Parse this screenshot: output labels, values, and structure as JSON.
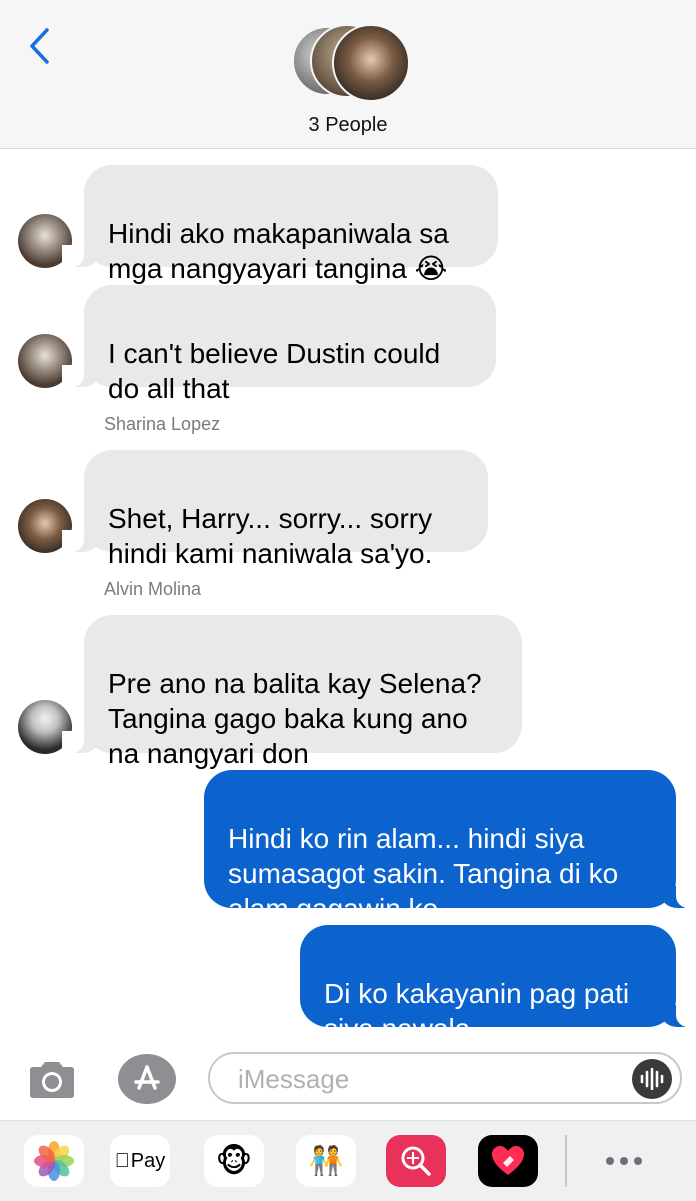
{
  "header": {
    "back_icon": "chevron-left-icon",
    "title": "3 People",
    "accent_color": "#1a6fe0"
  },
  "messages": [
    {
      "direction": "incoming",
      "sender": "",
      "text": "Hindi ako makapaniwala sa\nmga nangyayari tangina 😭"
    },
    {
      "direction": "incoming",
      "sender": "",
      "text": "I can't believe Dustin could\ndo all that"
    },
    {
      "direction": "incoming",
      "sender": "Sharina Lopez",
      "text": "Shet, Harry... sorry... sorry\nhindi kami naniwala sa'yo."
    },
    {
      "direction": "incoming",
      "sender": "Alvin Molina",
      "text": "Pre ano na balita kay Selena?\nTangina gago baka kung ano\nna nangyari don"
    },
    {
      "direction": "outgoing",
      "sender": "",
      "text": "Hindi ko rin alam... hindi siya\nsumasagot sakin. Tangina di ko\nalam gagawin ko"
    },
    {
      "direction": "outgoing",
      "sender": "",
      "text": "Di ko kakayanin pag pati\nsiya nawala"
    }
  ],
  "input": {
    "placeholder": "iMessage",
    "camera_icon": "camera-icon",
    "appstore_icon": "app-store-icon",
    "voice_icon": "waveform-icon"
  },
  "app_drawer": {
    "apps": [
      "photos-icon",
      "apple-pay-icon",
      "monkey-memoji-icon",
      "memoji-stickers-icon",
      "image-search-icon",
      "digital-touch-icon",
      "more-icon"
    ],
    "apple_pay_label": "Pay"
  },
  "colors": {
    "incoming_bubble": "#e9e9eb",
    "outgoing_bubble": "#0c63ce",
    "sender_name": "#7b7b80"
  }
}
